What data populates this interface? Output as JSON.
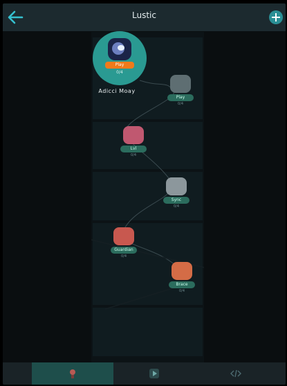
{
  "header": {
    "title": "Lustic",
    "back_icon": "arrow-left-icon",
    "add_icon": "plus-icon"
  },
  "current_level": {
    "button": "Play",
    "sub": "0/4",
    "label": "Adicci Moay"
  },
  "levels": [
    {
      "label": "Play",
      "sub": "0/4",
      "color": "#7c8c8f"
    },
    {
      "label": "Lvl",
      "sub": "0/4",
      "color": "#d2677a"
    },
    {
      "label": "Sync",
      "sub": "0/4",
      "color": "#9aa6ad"
    },
    {
      "label": "Guardian",
      "sub": "0/4",
      "color": "#d96a63"
    },
    {
      "label": "Brace",
      "sub": "0/4",
      "color": "#e0774e"
    }
  ],
  "tabs": [
    {
      "label": "",
      "icon": "map-icon",
      "active": true
    },
    {
      "label": "",
      "icon": "play-icon",
      "active": false
    },
    {
      "label": "",
      "icon": "code-icon",
      "active": false
    }
  ],
  "colors": {
    "accent": "#2a9a92",
    "button_orange": "#f07a1a",
    "topbar": "#1c2a2f"
  }
}
